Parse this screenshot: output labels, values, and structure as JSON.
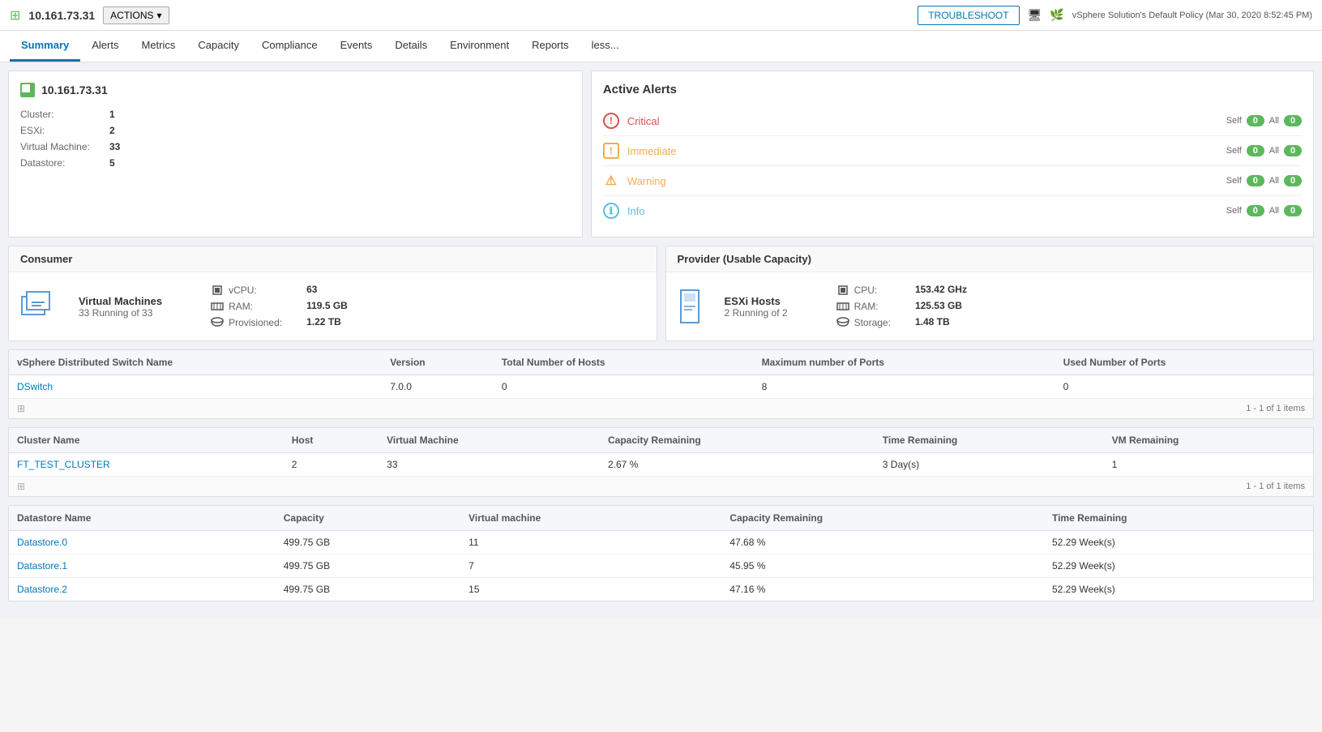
{
  "topbar": {
    "ip": "10.161.73.31",
    "actions_label": "ACTIONS",
    "troubleshoot_label": "TROUBLESHOOT",
    "policy_label": "vSphere Solution's Default Policy (Mar 30, 2020 8:52:45 PM)",
    "icons": {
      "vm_icon": "🟩",
      "monitor_icon": "🖥",
      "leaf_icon": "🌿"
    }
  },
  "nav": {
    "tabs": [
      "Summary",
      "Alerts",
      "Metrics",
      "Capacity",
      "Compliance",
      "Events",
      "Details",
      "Environment",
      "Reports",
      "less..."
    ],
    "active": "Summary"
  },
  "info_panel": {
    "hostname": "10.161.73.31",
    "fields": [
      {
        "label": "Cluster:",
        "value": "1"
      },
      {
        "label": "ESXi:",
        "value": "2"
      },
      {
        "label": "Virtual Machine:",
        "value": "33"
      },
      {
        "label": "Datastore:",
        "value": "5"
      }
    ]
  },
  "alerts_panel": {
    "title": "Active Alerts",
    "rows": [
      {
        "type": "critical",
        "icon": "!",
        "name": "Critical",
        "self": "0",
        "all": "0"
      },
      {
        "type": "immediate",
        "icon": "!",
        "name": "Immediate",
        "self": "0",
        "all": "0"
      },
      {
        "type": "warning",
        "icon": "⚠",
        "name": "Warning",
        "self": "0",
        "all": "0"
      },
      {
        "type": "info",
        "icon": "ℹ",
        "name": "Info",
        "self": "0",
        "all": "0"
      }
    ]
  },
  "consumer": {
    "header": "Consumer",
    "label": "Virtual Machines",
    "sublabel": "33 Running of 33",
    "stats": [
      {
        "label": "vCPU:",
        "value": "63"
      },
      {
        "label": "RAM:",
        "value": "119.5 GB"
      },
      {
        "label": "Provisioned:",
        "value": "1.22 TB"
      }
    ]
  },
  "provider": {
    "header": "Provider (Usable Capacity)",
    "label": "ESXi Hosts",
    "sublabel": "2 Running of 2",
    "stats": [
      {
        "label": "CPU:",
        "value": "153.42 GHz"
      },
      {
        "label": "RAM:",
        "value": "125.53 GB"
      },
      {
        "label": "Storage:",
        "value": "1.48 TB"
      }
    ]
  },
  "vds_table": {
    "columns": [
      "vSphere Distributed Switch Name",
      "Version",
      "Total Number of Hosts",
      "Maximum number of Ports",
      "Used Number of Ports"
    ],
    "rows": [
      {
        "name": "DSwitch",
        "version": "7.0.0",
        "total_hosts": "0",
        "max_ports": "8",
        "used_ports": "0"
      }
    ],
    "pagination": "1 - 1 of 1 items"
  },
  "cluster_table": {
    "columns": [
      "Cluster Name",
      "Host",
      "Virtual Machine",
      "Capacity Remaining",
      "Time Remaining",
      "VM Remaining"
    ],
    "rows": [
      {
        "name": "FT_TEST_CLUSTER",
        "host": "2",
        "vm": "33",
        "capacity": "2.67 %",
        "time": "3 Day(s)",
        "vm_remaining": "1"
      }
    ],
    "pagination": "1 - 1 of 1 items"
  },
  "datastore_table": {
    "columns": [
      "Datastore Name",
      "Capacity",
      "Virtual machine",
      "Capacity Remaining",
      "Time Remaining"
    ],
    "rows": [
      {
        "name": "Datastore.0",
        "capacity": "499.75 GB",
        "vm": "11",
        "cap_remaining": "47.68 %",
        "time": "52.29 Week(s)"
      },
      {
        "name": "Datastore.1",
        "capacity": "499.75 GB",
        "vm": "7",
        "cap_remaining": "45.95 %",
        "time": "52.29 Week(s)"
      },
      {
        "name": "Datastore.2",
        "capacity": "499.75 GB",
        "vm": "15",
        "cap_remaining": "47.16 %",
        "time": "52.29 Week(s)"
      }
    ]
  }
}
